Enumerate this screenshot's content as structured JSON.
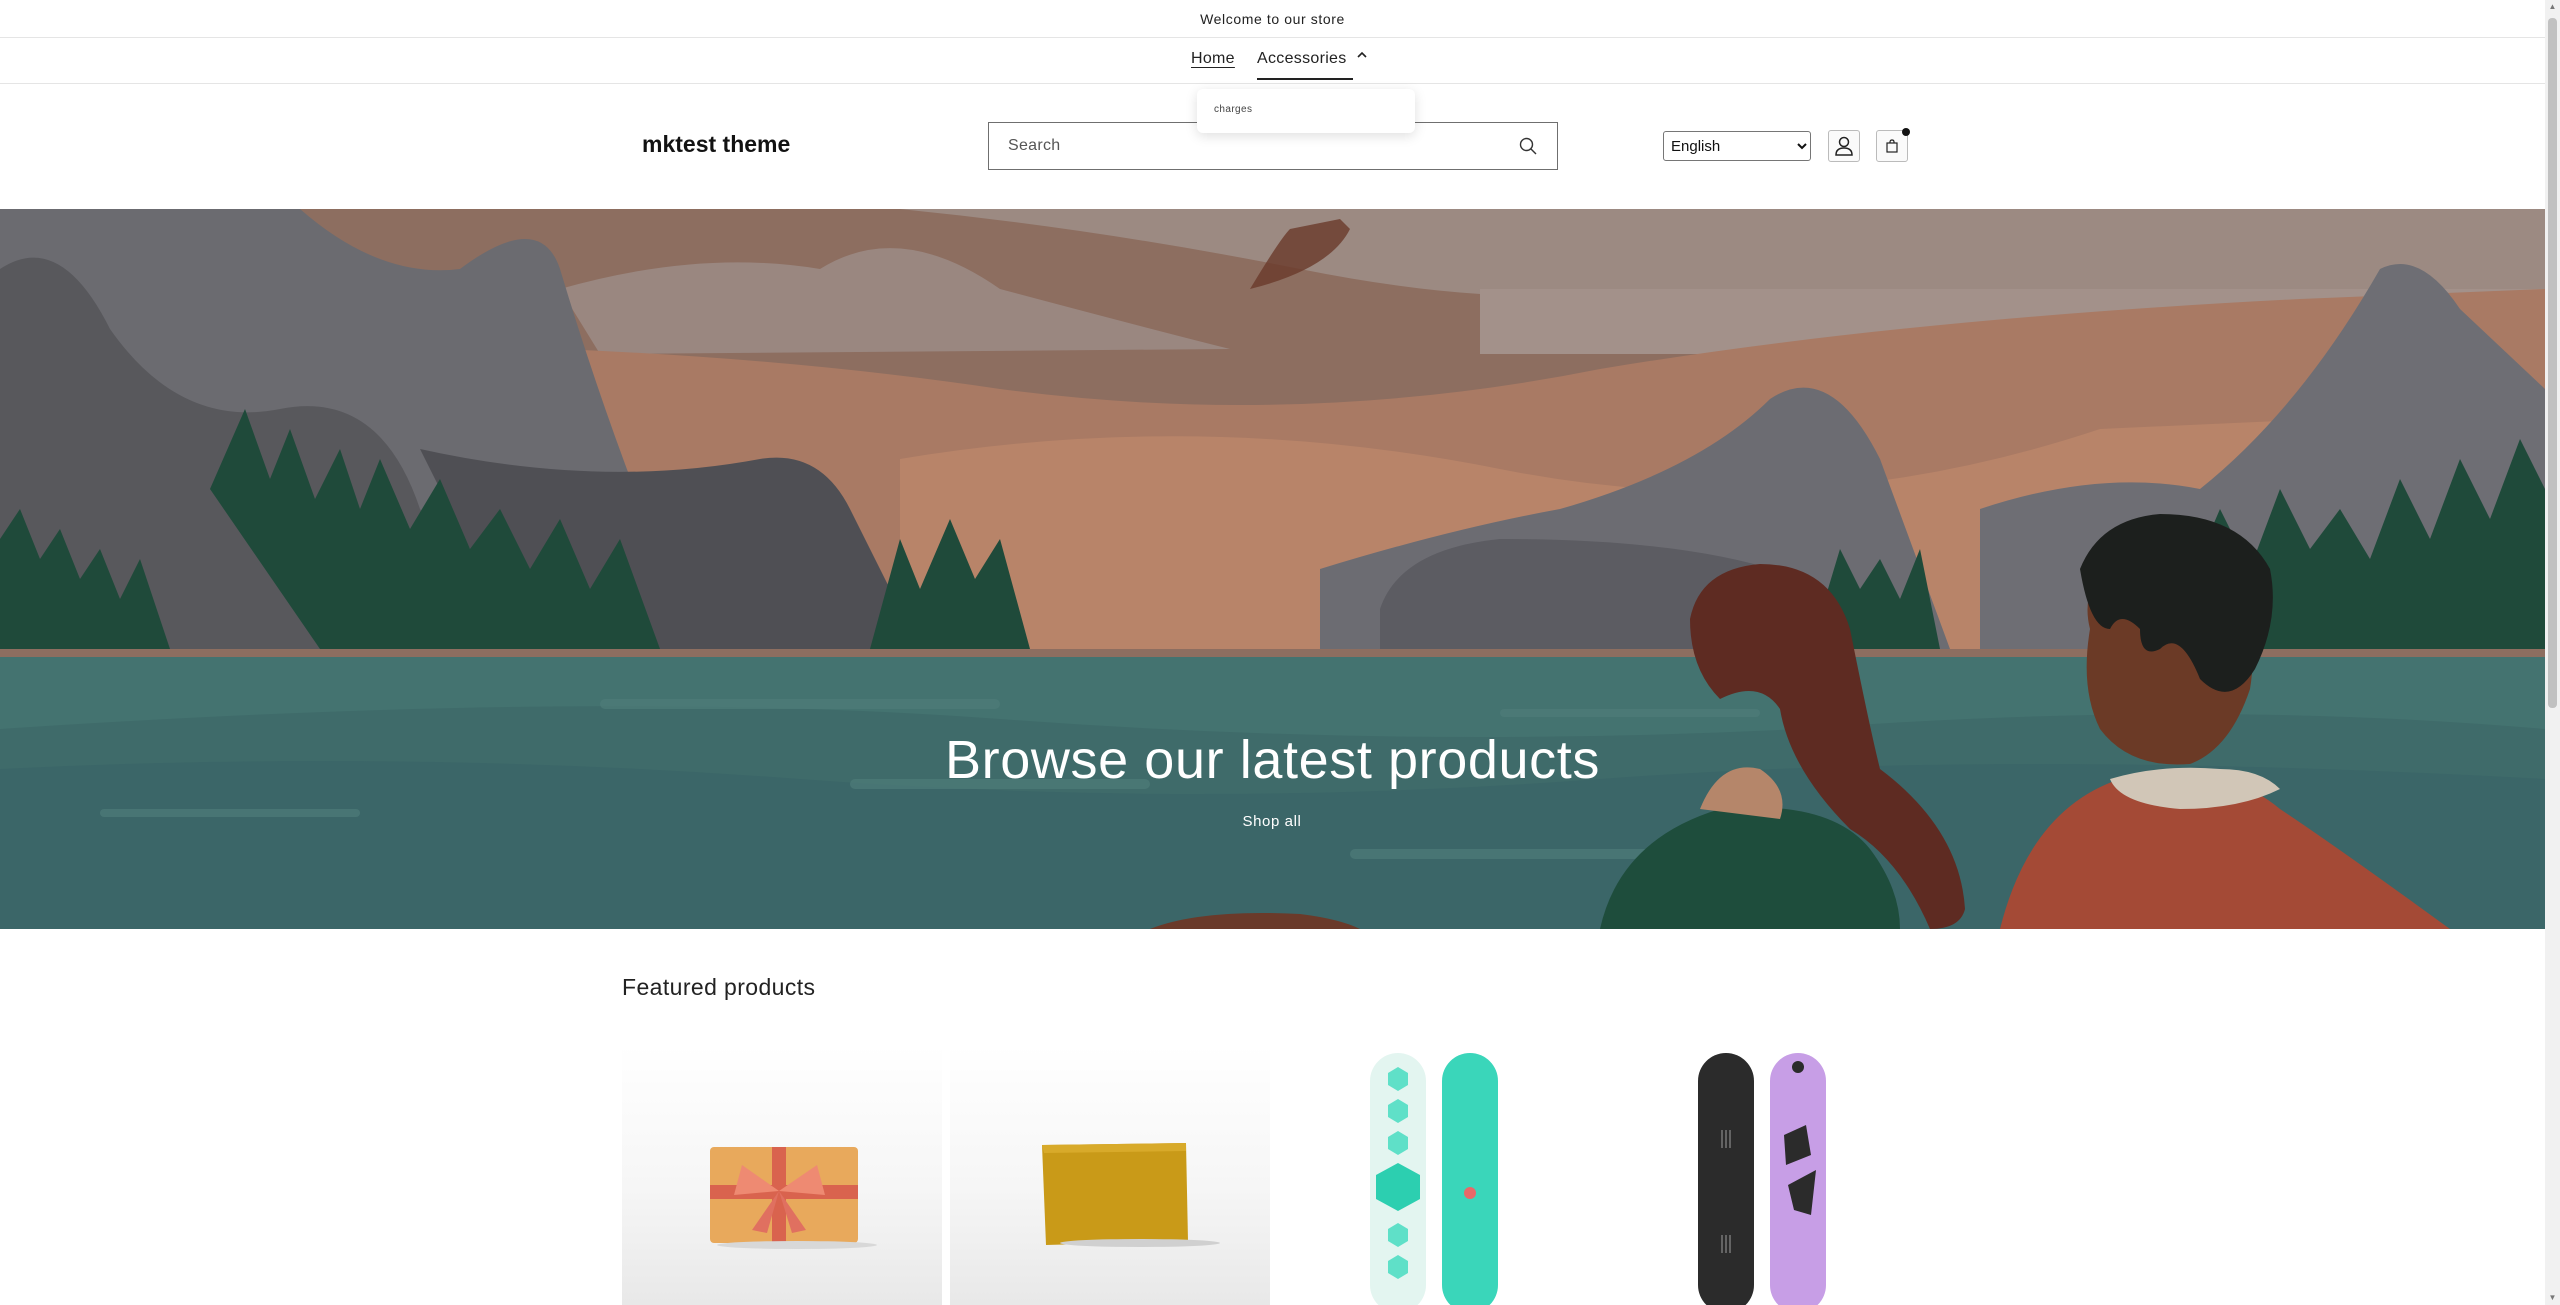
{
  "announcement": {
    "text": "Welcome to our store"
  },
  "nav": {
    "items": [
      {
        "label": "Home"
      },
      {
        "label": "Accessories"
      }
    ],
    "dropdown": {
      "items": [
        {
          "label": "charges"
        }
      ]
    }
  },
  "header": {
    "logo": "mktest theme",
    "search": {
      "placeholder": "Search"
    },
    "language": {
      "selected": "English"
    }
  },
  "hero": {
    "title": "Browse our latest products",
    "button_label": "Shop all"
  },
  "featured": {
    "title": "Featured products",
    "products": [
      {
        "image": "gift-card"
      },
      {
        "image": "wax-block"
      },
      {
        "image": "snowboard-teal"
      },
      {
        "image": "snowboard-purple"
      }
    ]
  },
  "icons": {
    "search": "search-icon",
    "account": "user-icon",
    "cart": "bag-icon",
    "chevron": "chevron-up-icon"
  }
}
